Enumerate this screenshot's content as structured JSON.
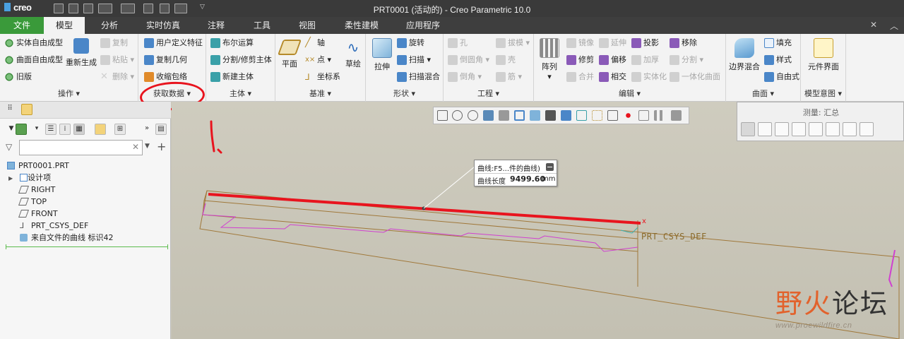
{
  "window": {
    "logo": "creo",
    "title": "PRT0001 (活动的) - Creo Parametric 10.0"
  },
  "tabs": {
    "file": "文件",
    "items": [
      "模型",
      "分析",
      "实时仿真",
      "注释",
      "工具",
      "视图",
      "柔性建模",
      "应用程序"
    ]
  },
  "ribbon": {
    "ops": {
      "title": "操作",
      "items": [
        "实体自由成型",
        "曲面自由成型",
        "旧版"
      ],
      "regen": "重新生成",
      "copy": "复制",
      "paste": "粘贴",
      "delete": "删除"
    },
    "getdata": {
      "title": "获取数据",
      "items": [
        "用户定义特征",
        "复制几何",
        "收缩包络"
      ]
    },
    "body": {
      "title": "主体",
      "items": [
        "布尔运算",
        "分割/修剪主体",
        "新建主体"
      ]
    },
    "datum": {
      "title": "基准",
      "plane": "平面",
      "axis": "轴",
      "point": "点",
      "csys": "坐标系",
      "sketch": "草绘"
    },
    "shape": {
      "title": "形状",
      "extrude": "拉伸",
      "revolve": "旋转",
      "sweep": "扫描",
      "blend": "扫描混合"
    },
    "eng": {
      "title": "工程",
      "hole": "孔",
      "draft": "拔模",
      "round": "倒圆角",
      "shell": "壳",
      "chamfer": "倒角",
      "rib": "筋"
    },
    "edit": {
      "title": "编辑",
      "pattern": "阵列",
      "mirror": "镜像",
      "extend": "延伸",
      "project": "投影",
      "remove": "移除",
      "trim": "修剪",
      "offset": "偏移",
      "thicken": "加厚",
      "split": "分割",
      "merge": "合并",
      "intersect": "相交",
      "solidify": "实体化",
      "unify": "一体化曲面"
    },
    "surfaces": {
      "title": "曲面",
      "boundary": "边界混合",
      "fill": "填充",
      "style": "样式",
      "freestyle": "自由式"
    },
    "intent": {
      "title": "模型意图",
      "ui": "元件界面"
    }
  },
  "tree": {
    "filter_placeholder": "",
    "items": [
      "PRT0001.PRT",
      "设计项",
      "RIGHT",
      "TOP",
      "FRONT",
      "PRT_CSYS_DEF",
      "来自文件的曲线 标识42"
    ]
  },
  "viewport": {
    "measure_title": "测量: 汇总",
    "callout_name": "曲线:F5...件的曲线)",
    "callout_label": "曲线长度",
    "callout_value": "9499.60",
    "callout_unit": "mm",
    "csys_label": "PRT_CSYS_DEF",
    "annotation": "1."
  },
  "watermark": {
    "title_a": "野火",
    "title_b": "论坛",
    "url": "www.proewildfire.cn"
  },
  "colors": {
    "accent_green": "#3a9a3a",
    "highlight_red": "#e8141e",
    "curve_magenta": "#d040d0"
  }
}
